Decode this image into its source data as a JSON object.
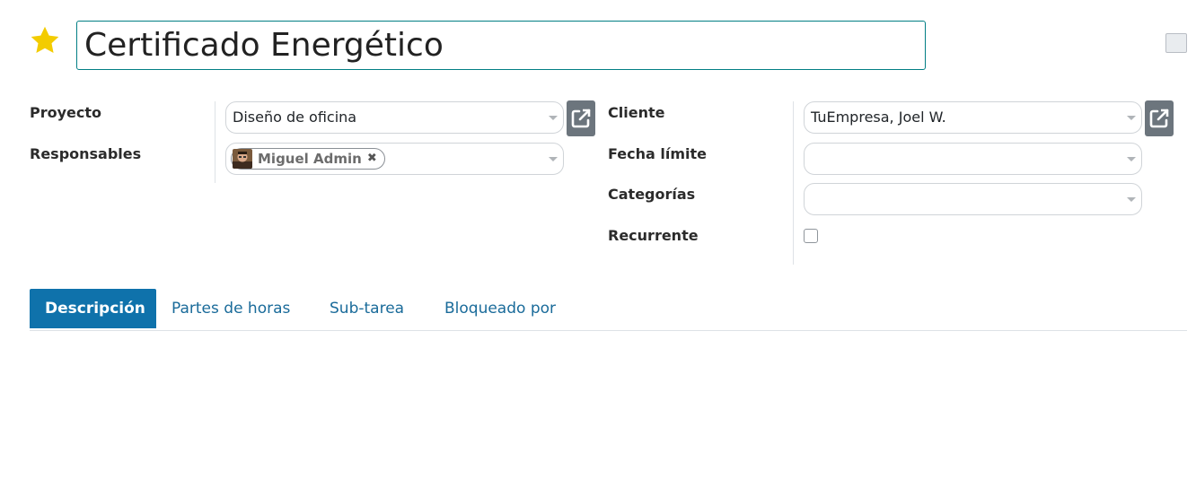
{
  "task": {
    "title": "Certificado Energético",
    "priority_starred": true
  },
  "colors": {
    "star": "#f3cc00",
    "title_border": "#017e84",
    "active_tab_bg": "#0f72ab",
    "tab_link": "#1a6b9a",
    "external_button": "#6c757d"
  },
  "left_fields": {
    "project_label": "Proyecto",
    "project_value": "Diseño de oficina",
    "assignees_label": "Responsables",
    "assignee_tag": "Miguel Admin"
  },
  "right_fields": {
    "customer_label": "Cliente",
    "customer_value": "TuEmpresa, Joel W.",
    "deadline_label": "Fecha límite",
    "deadline_value": "",
    "tags_label": "Categorías",
    "tags_value": "",
    "recurring_label": "Recurrente",
    "recurring_checked": false
  },
  "tabs": [
    {
      "label": "Descripción",
      "active": true
    },
    {
      "label": "Partes de horas",
      "active": false
    },
    {
      "label": "Sub-tarea",
      "active": false
    },
    {
      "label": "Bloqueado por",
      "active": false
    }
  ],
  "icons": {
    "star": "star-icon",
    "external": "external-link-icon",
    "remove": "close-icon",
    "caret": "caret-down-icon"
  }
}
